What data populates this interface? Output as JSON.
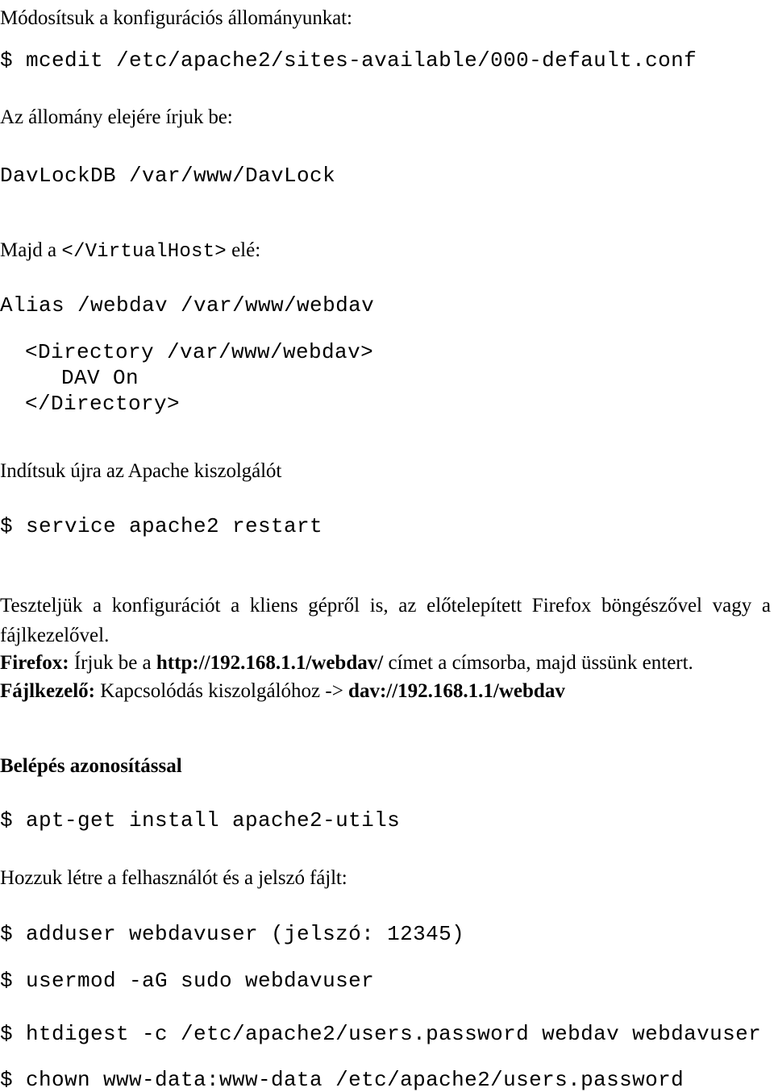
{
  "document": {
    "language": "hu",
    "kind": "tutorial-page",
    "topic": "WebDAV on Apache2"
  },
  "blocks": {
    "intro_heading": "Módosítsuk a konfigurációs állományunkat:",
    "cmd_mcedit": "$ mcedit /etc/apache2/sites-available/000-default.conf",
    "file_start_heading": "Az állomány elejére írjuk be:",
    "cfg_davlockdb": "DavLockDB /var/www/DavLock",
    "before_vhost_prefix": "Majd a ",
    "before_vhost_code": "</VirtualHost>",
    "before_vhost_suffix": " elé:",
    "cfg_alias": "Alias /webdav /var/www/webdav",
    "cfg_directory_open": "<Directory /var/www/webdav>",
    "cfg_dav_on": "DAV On",
    "cfg_directory_close": "</Directory>",
    "restart_heading": "Indítsuk újra az Apache kiszolgálót",
    "cmd_restart": "$ service apache2 restart",
    "test_paragraph": "Teszteljük a konfigurációt a kliens gépről is, az előtelepített Firefox böngészővel vagy a fájlkezelővel.",
    "firefox_label": "Firefox:",
    "firefox_text_1": " Írjuk be a ",
    "firefox_url": "http://192.168.1.1/webdav/",
    "firefox_text_2": " címet a címsorba, majd üssünk entert.",
    "filemanager_label": "Fájlkezelő:",
    "filemanager_text_1": " Kapcsolódás kiszolgálóhoz -> ",
    "filemanager_url": "dav://192.168.1.1/webdav",
    "auth_heading": "Belépés azonosítással",
    "cmd_aptget": "$ apt-get install apache2-utils",
    "create_user_heading": "Hozzuk létre a felhasználót és a jelszó fájlt:",
    "cmd_adduser": "$ adduser webdavuser (jelszó: 12345)",
    "cmd_usermod": "$ usermod -aG sudo webdavuser",
    "cmd_htdigest": "$ htdigest -c /etc/apache2/users.password webdav webdavuser",
    "cmd_chown": "$ chown www-data:www-data /etc/apache2/users.password"
  },
  "colors": {
    "page_background": "#ffffff",
    "text": "#000000"
  }
}
